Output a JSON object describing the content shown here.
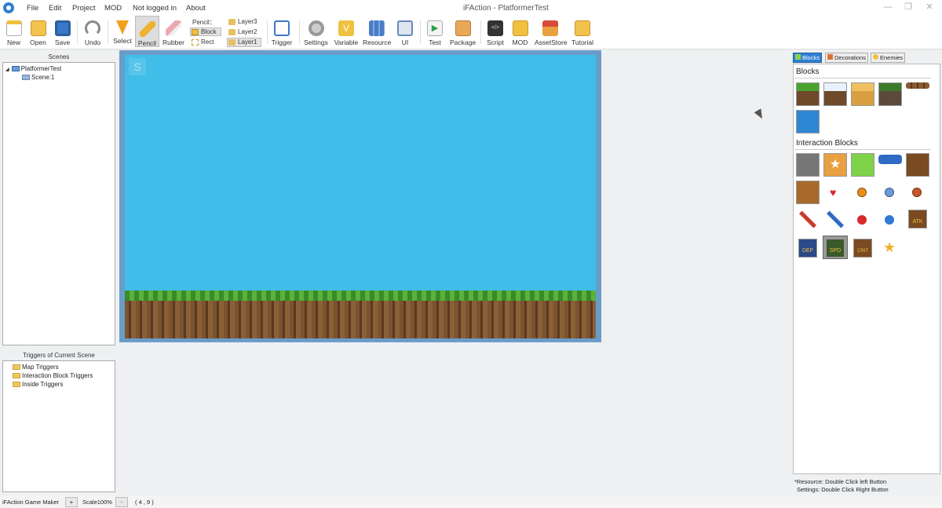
{
  "menubar": {
    "items": [
      "File",
      "Edit",
      "Project",
      "MOD",
      "Not logged in",
      "About"
    ],
    "title": "iFAction - PlatformerTest"
  },
  "toolbar": {
    "new": "New",
    "open": "Open",
    "save": "Save",
    "undo": "Undo",
    "select": "Select",
    "pencil": "Pencil",
    "rubber": "Rubber",
    "pencil_mode_label": "Pencil：",
    "block": "Block",
    "rect": "Rect",
    "layers": [
      "Layer3",
      "Layer2",
      "Layer1"
    ],
    "trigger": "Trigger",
    "settings": "Settings",
    "variable": "Variable",
    "resource": "Resource",
    "ui": "UI",
    "test": "Test",
    "package": "Package",
    "script": "Script",
    "mod": "MOD",
    "assetstore": "AssetStore",
    "tutorial": "Tutorial"
  },
  "scenes": {
    "header": "Scenes",
    "project": "PlatformerTest",
    "scene": "Scene:1"
  },
  "triggers": {
    "header": "Triggers of Current Scene",
    "items": [
      "Map Triggers",
      "Interaction Block Triggers",
      "Inside Triggers"
    ]
  },
  "right": {
    "tabs": [
      "Blocks",
      "Decorations",
      "Enemies"
    ],
    "blocks_title": "Blocks",
    "interaction_title": "Interaction Blocks",
    "tile_labels": {
      "atk": "ATK",
      "def": "DEF",
      "spd": "SPD",
      "crit": "CRIT"
    },
    "hint1": "*Resource: Double Click left Button",
    "hint2": "Settings: Double Click Right Button"
  },
  "canvas": {
    "marker": "S"
  },
  "status": {
    "app": "iFAction Game Maker",
    "plus": "+",
    "scale": "Scale100%",
    "minus": "-",
    "coords": "( 4 , 9 )"
  },
  "colors": {
    "sky": "#40bde8",
    "accent": "#2e7fd1"
  }
}
